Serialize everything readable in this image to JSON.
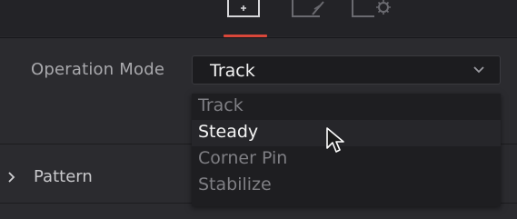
{
  "header": {
    "tabs": [
      {
        "icon": "tracker-tab-icon",
        "active": true
      },
      {
        "icon": "edit-tab-icon",
        "active": false
      },
      {
        "icon": "settings-tab-icon",
        "active": false
      }
    ],
    "accent_color": "#d9473a"
  },
  "operation_mode": {
    "label": "Operation Mode",
    "value": "Track",
    "options": [
      "Track",
      "Steady",
      "Corner Pin",
      "Stabilize"
    ],
    "hovered": "Steady"
  },
  "sections": [
    {
      "label": "Pattern",
      "expanded": false
    }
  ]
}
